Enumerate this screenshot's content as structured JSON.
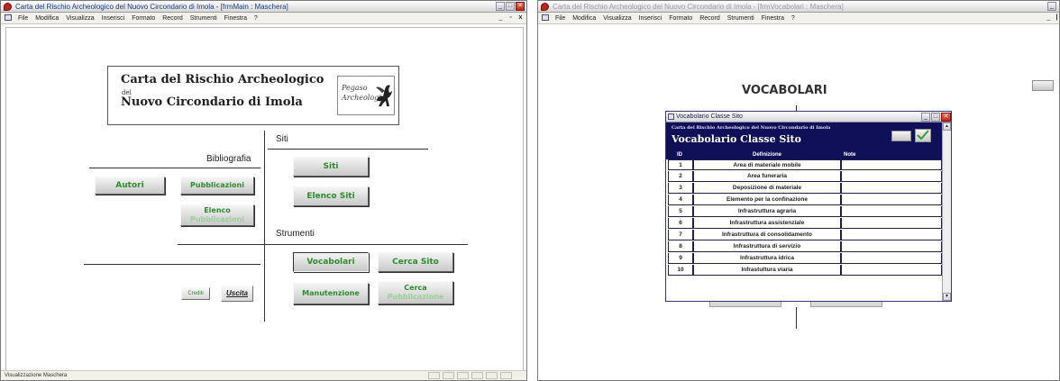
{
  "left_window": {
    "title": "Carta del Rischio Archeologico del Nuovo Circondario di Imola - [frmMain : Maschera]",
    "menu": [
      "File",
      "Modifica",
      "Visualizza",
      "Inserisci",
      "Formato",
      "Record",
      "Strumenti",
      "Finestra",
      "?"
    ],
    "controls": {
      "minimize": "_",
      "maximize": "□",
      "close": "✕",
      "mdi_min": "_",
      "mdi_max": "▫",
      "mdi_close": "x"
    },
    "status_text": "Visualizzazione Maschera",
    "header": {
      "line1": "Carta del Rischio Archeologico",
      "del": "del",
      "line2": "Nuovo Circondario di Imola"
    },
    "logo": {
      "line1": "Pegaso",
      "line2": "Archeologia"
    },
    "sections": {
      "siti": "Siti",
      "bibliografia": "Bibliografia",
      "strumenti": "Strumenti"
    },
    "buttons": {
      "siti": "Siti",
      "elenco_siti": "Elenco Siti",
      "autori": "Autori",
      "pubblicazioni": "Pubblicazioni",
      "elenco_pub_1": "Elenco",
      "elenco_pub_2": "Pubblicazioni",
      "vocabolari": "Vocabolari",
      "cerca_sito": "Cerca Sito",
      "manutenzione": "Manutenzione",
      "cerca_pub_1": "Cerca",
      "cerca_pub_2": "Pubblicazione",
      "crediti": "Crediti",
      "uscita": "Uscita"
    }
  },
  "right_window": {
    "title": "Carta del Rischio Archeologico del Nuovo Circondario di Imola - [frmVocabolari : Maschera]",
    "menu": [
      "File",
      "Modifica",
      "Visualizza",
      "Inserisci",
      "Formato",
      "Record",
      "Strumenti",
      "Finestra",
      "?"
    ],
    "heading": "VOCABOLARI",
    "dialog": {
      "title": "Vocabolario Classe Sito",
      "subheader": "Carta del Rischio Archeologico del Nuovo Circondario di Imola",
      "header": "Vocabolario Classe Sito",
      "columns": [
        "ID",
        "Definizione",
        "Note"
      ],
      "rows": [
        {
          "id": "1",
          "def": "Area di materiale mobile",
          "note": ""
        },
        {
          "id": "2",
          "def": "Area funeraria",
          "note": ""
        },
        {
          "id": "3",
          "def": "Deposizione di materiale",
          "note": ""
        },
        {
          "id": "4",
          "def": "Elemento per la confinazione",
          "note": ""
        },
        {
          "id": "5",
          "def": "Infrastruttura agraria",
          "note": ""
        },
        {
          "id": "6",
          "def": "Infrastruttura assistenziale",
          "note": ""
        },
        {
          "id": "7",
          "def": "Infrastruttura di consolidamento",
          "note": ""
        },
        {
          "id": "8",
          "def": "Infrastruttura di servizio",
          "note": ""
        },
        {
          "id": "9",
          "def": "Infrastruttura idrica",
          "note": ""
        },
        {
          "id": "10",
          "def": "Infrastuttura viaria",
          "note": ""
        }
      ]
    }
  },
  "colors": {
    "button_text": "#2e8c2e",
    "dialog_header": "#101058",
    "close_red": "#c02818"
  }
}
